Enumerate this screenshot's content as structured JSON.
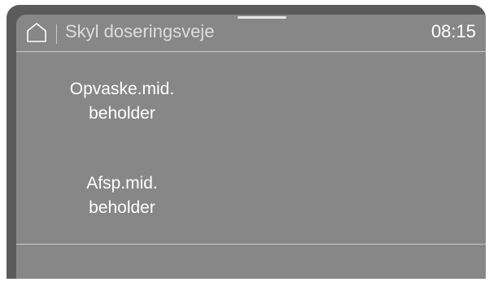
{
  "header": {
    "home_icon": "home-icon",
    "title": "Skyl doseringsveje",
    "time": "08:15"
  },
  "options": [
    {
      "line1": "Opvaske.mid.",
      "line2": "beholder"
    },
    {
      "line1": "Afsp.mid.",
      "line2": "beholder"
    }
  ],
  "colors": {
    "bezel": "#5b5b5b",
    "screen": "#878787",
    "text": "#ffffff",
    "divider": "#c8c8c8"
  }
}
